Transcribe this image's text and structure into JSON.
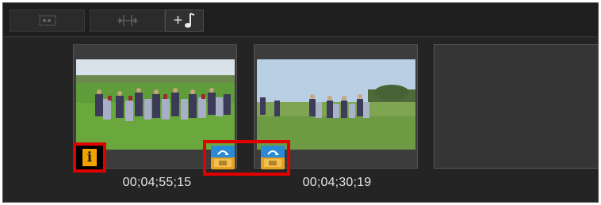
{
  "toolbar": {
    "buttons": [
      {
        "icon": "storyboard-icon",
        "enabled": false
      },
      {
        "icon": "trim-icon",
        "enabled": false
      },
      {
        "icon": "add-music-icon",
        "label": "+",
        "enabled": true
      }
    ]
  },
  "clips": [
    {
      "timecode": "00;04;55;15",
      "has_info_badge": true
    },
    {
      "timecode": "00;04;30;19",
      "has_info_badge": false
    }
  ],
  "info_badge": {
    "glyph": "i"
  },
  "transitions": [
    {
      "icon": "transition-icon"
    },
    {
      "icon": "transition-icon"
    }
  ],
  "colors": {
    "highlight": "#e00000",
    "badge": "#f0a200",
    "transition_top": "#2a8ad4",
    "transition_bottom": "#e8a020"
  }
}
